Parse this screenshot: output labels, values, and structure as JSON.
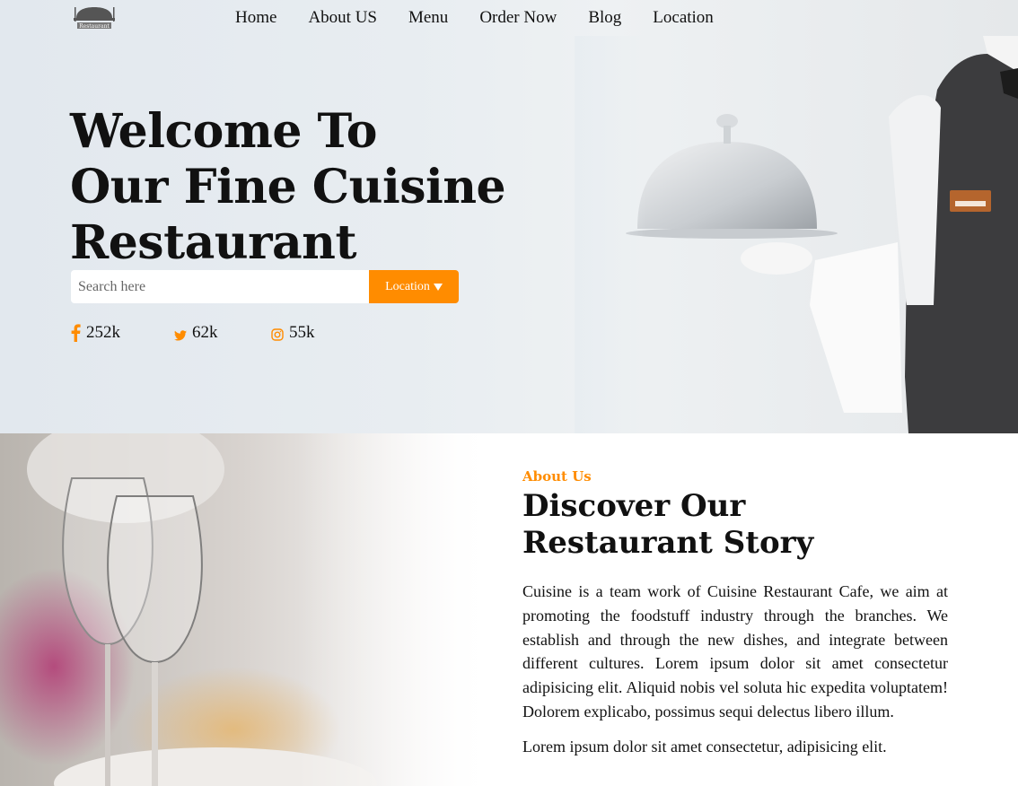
{
  "nav": {
    "logo_text": "Restaurant",
    "links": [
      "Home",
      "About US",
      "Menu",
      "Order Now",
      "Blog",
      "Location"
    ]
  },
  "hero": {
    "title_lines": [
      "Welcome To",
      "Our Fine Cuisine",
      "Restaurant"
    ],
    "search_placeholder": "Search here",
    "location_button": "Location",
    "social": [
      {
        "icon": "facebook-icon",
        "count": "252k"
      },
      {
        "icon": "twitter-icon",
        "count": "62k"
      },
      {
        "icon": "instagram-icon",
        "count": "55k"
      }
    ]
  },
  "about": {
    "label": "About Us",
    "title_lines": [
      "Discover Our",
      "Restaurant Story"
    ],
    "paragraph1": "Cuisine is a team work of Cuisine Restaurant Cafe, we aim at promoting the foodstuff industry through the branches. We establish and through the new dishes, and integrate between different cultures. Lorem ipsum dolor sit amet consectetur adipisicing elit. Aliquid nobis vel soluta hic expedita voluptatem! Dolorem explicabo, possimus sequi delectus libero illum.",
    "paragraph2": "Lorem ipsum dolor sit amet consectetur, adipisicing elit."
  },
  "colors": {
    "accent": "#ff8c00",
    "hero_bg": "#e6ebef",
    "text": "#111111"
  }
}
